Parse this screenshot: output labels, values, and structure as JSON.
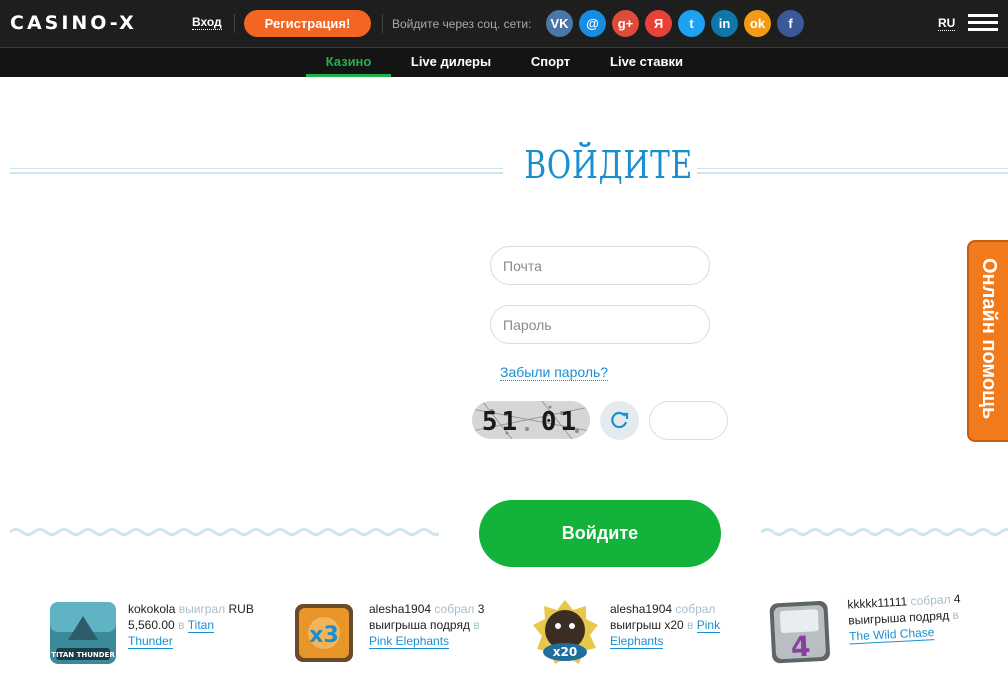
{
  "header": {
    "logo": "CASINO-X",
    "login_label": "Вход",
    "register_label": "Регистрация!",
    "social_text": "Войдите через соц. сети:",
    "language": "RU",
    "social": [
      {
        "name": "vk-icon",
        "glyph": "VK",
        "color": "#4a76a8"
      },
      {
        "name": "mailru-icon",
        "glyph": "@",
        "color": "#168de2"
      },
      {
        "name": "google-plus-icon",
        "glyph": "g+",
        "color": "#dd4b39"
      },
      {
        "name": "yandex-icon",
        "glyph": "Я",
        "color": "#e9413a"
      },
      {
        "name": "twitter-icon",
        "glyph": "t",
        "color": "#1da1f2"
      },
      {
        "name": "linkedin-icon",
        "glyph": "in",
        "color": "#0e76a8"
      },
      {
        "name": "odnoklassniki-icon",
        "glyph": "ok",
        "color": "#f59a16"
      },
      {
        "name": "facebook-icon",
        "glyph": "f",
        "color": "#3b5998"
      }
    ]
  },
  "nav": {
    "items": [
      {
        "label": "Казино",
        "active": true
      },
      {
        "label": "Live дилеры",
        "active": false
      },
      {
        "label": "Спорт",
        "active": false
      },
      {
        "label": "Live ставки",
        "active": false
      }
    ]
  },
  "form": {
    "heading": "ВОЙДИТЕ",
    "email_placeholder": "Почта",
    "password_placeholder": "Пароль",
    "forgot_label": "Забыли пароль?",
    "captcha_text": "51 01",
    "submit_label": "Войдите"
  },
  "help": {
    "label": "Онлайн помощь"
  },
  "winners": [
    {
      "user": "kokokola",
      "action": "выиграл",
      "amount": "RUB 5,560.00",
      "prep": "в",
      "game": "Titan Thunder",
      "thumb_color": "#3a8a9a"
    },
    {
      "user": "alesha1904",
      "action": "собрал",
      "amount": "3 выигрыша подряд",
      "prep": "в",
      "game": "Pink Elephants",
      "thumb_color": "#e8962a",
      "badge": "x3"
    },
    {
      "user": "alesha1904",
      "action": "собрал",
      "amount": "выигрыш x20",
      "prep": "в",
      "game": "Pink Elephants",
      "thumb_color": "#1f6f9e",
      "badge": "x20"
    },
    {
      "user": "kkkkk11111",
      "action": "собрал",
      "amount": "4 выигрыша подряд",
      "prep": "в",
      "game": "The Wild Chase",
      "thumb_color": "#8a8f92",
      "badge": "4"
    }
  ]
}
